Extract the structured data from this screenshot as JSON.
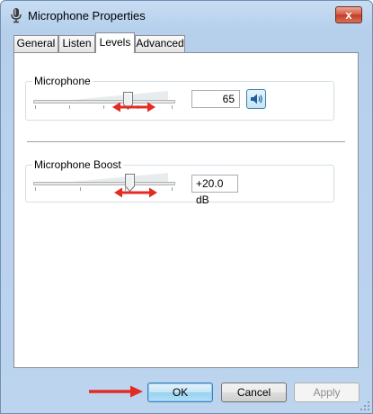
{
  "window": {
    "title": "Microphone Properties",
    "close_glyph": "x"
  },
  "tabs": [
    {
      "label": "General"
    },
    {
      "label": "Listen"
    },
    {
      "label": "Levels",
      "active": true
    },
    {
      "label": "Advanced"
    }
  ],
  "levels": {
    "microphone": {
      "label": "Microphone",
      "value": "65"
    },
    "boost": {
      "label": "Microphone Boost",
      "value": "+20.0 dB"
    }
  },
  "buttons": {
    "ok": "OK",
    "cancel": "Cancel",
    "apply": "Apply"
  },
  "icons": {
    "title": "microphone-icon",
    "speaker": "speaker-icon",
    "arrows": "red-arrow-annotation"
  },
  "colors": {
    "annotation": "#e32b24",
    "accent": "#3c7fb1"
  }
}
